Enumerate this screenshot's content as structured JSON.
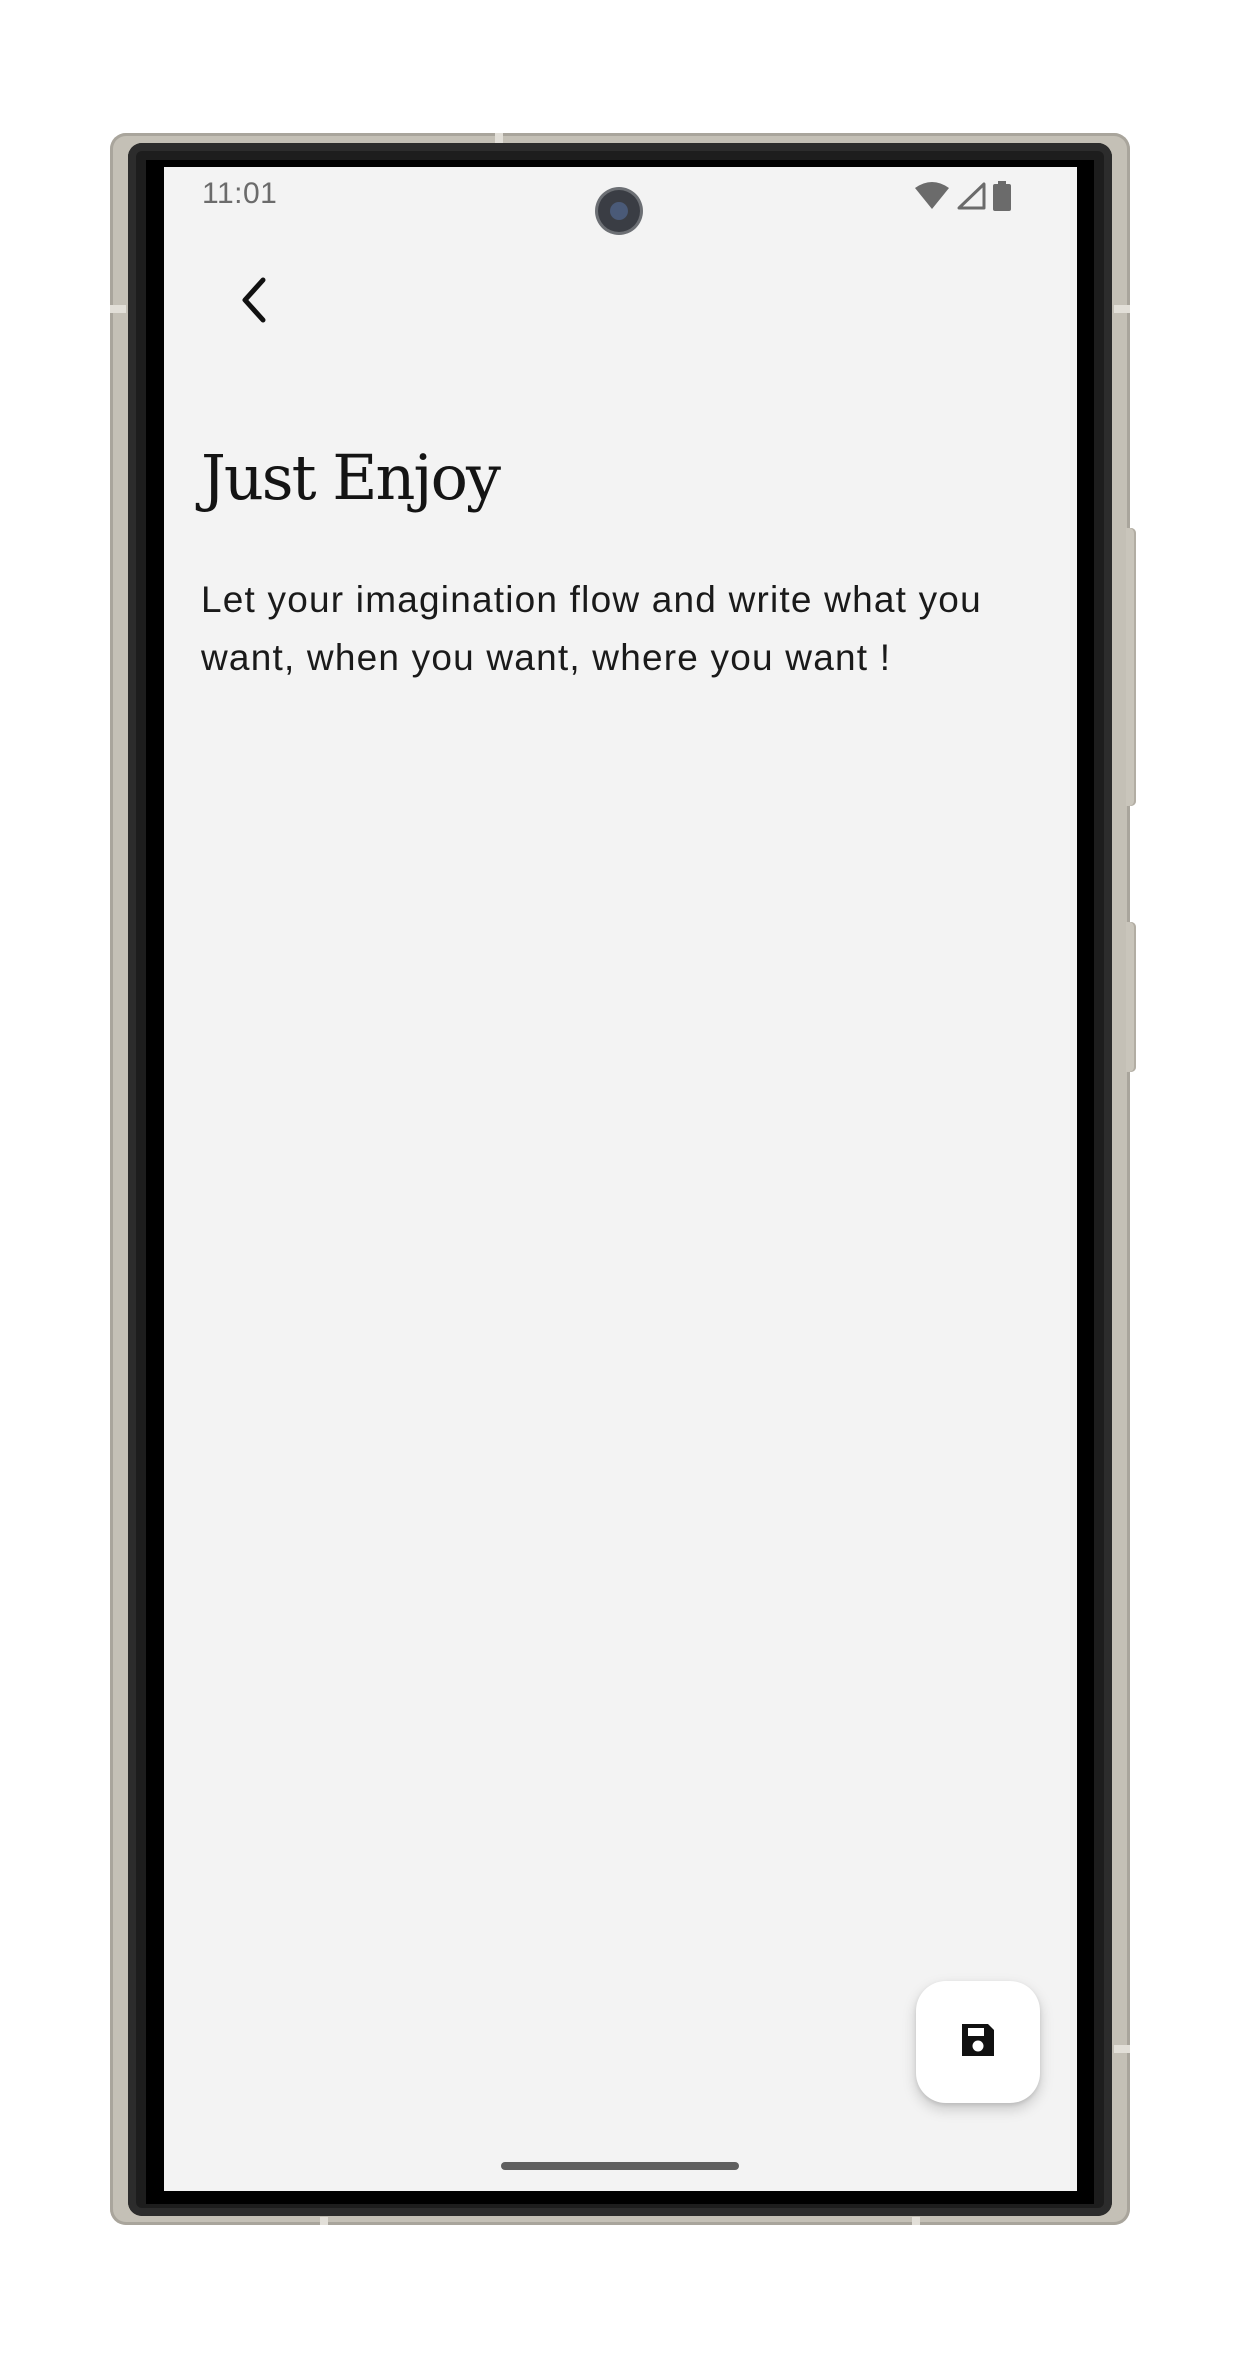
{
  "status_bar": {
    "time": "11:01",
    "icons": [
      "wifi-icon",
      "cell-signal-icon",
      "battery-icon"
    ]
  },
  "toolbar": {
    "back_icon": "chevron-left-icon"
  },
  "note": {
    "title": "Just Enjoy",
    "body": "Let your imagination flow and write what you want, when you want, where you want !"
  },
  "fab": {
    "icon": "save-icon"
  },
  "colors": {
    "background": "#f3f3f3",
    "text": "#1a1a1a",
    "fab_background": "#ffffff",
    "frame": "#c4c0b6"
  }
}
